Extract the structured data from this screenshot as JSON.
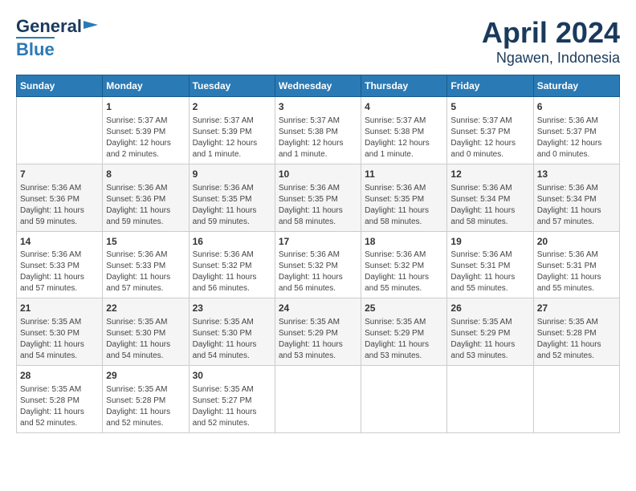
{
  "header": {
    "logo_line1": "General",
    "logo_line2": "Blue",
    "title": "April 2024",
    "subtitle": "Ngawen, Indonesia"
  },
  "columns": [
    "Sunday",
    "Monday",
    "Tuesday",
    "Wednesday",
    "Thursday",
    "Friday",
    "Saturday"
  ],
  "weeks": [
    [
      {
        "day": "",
        "info": ""
      },
      {
        "day": "1",
        "info": "Sunrise: 5:37 AM\nSunset: 5:39 PM\nDaylight: 12 hours\nand 2 minutes."
      },
      {
        "day": "2",
        "info": "Sunrise: 5:37 AM\nSunset: 5:39 PM\nDaylight: 12 hours\nand 1 minute."
      },
      {
        "day": "3",
        "info": "Sunrise: 5:37 AM\nSunset: 5:38 PM\nDaylight: 12 hours\nand 1 minute."
      },
      {
        "day": "4",
        "info": "Sunrise: 5:37 AM\nSunset: 5:38 PM\nDaylight: 12 hours\nand 1 minute."
      },
      {
        "day": "5",
        "info": "Sunrise: 5:37 AM\nSunset: 5:37 PM\nDaylight: 12 hours\nand 0 minutes."
      },
      {
        "day": "6",
        "info": "Sunrise: 5:36 AM\nSunset: 5:37 PM\nDaylight: 12 hours\nand 0 minutes."
      }
    ],
    [
      {
        "day": "7",
        "info": "Sunrise: 5:36 AM\nSunset: 5:36 PM\nDaylight: 11 hours\nand 59 minutes."
      },
      {
        "day": "8",
        "info": "Sunrise: 5:36 AM\nSunset: 5:36 PM\nDaylight: 11 hours\nand 59 minutes."
      },
      {
        "day": "9",
        "info": "Sunrise: 5:36 AM\nSunset: 5:35 PM\nDaylight: 11 hours\nand 59 minutes."
      },
      {
        "day": "10",
        "info": "Sunrise: 5:36 AM\nSunset: 5:35 PM\nDaylight: 11 hours\nand 58 minutes."
      },
      {
        "day": "11",
        "info": "Sunrise: 5:36 AM\nSunset: 5:35 PM\nDaylight: 11 hours\nand 58 minutes."
      },
      {
        "day": "12",
        "info": "Sunrise: 5:36 AM\nSunset: 5:34 PM\nDaylight: 11 hours\nand 58 minutes."
      },
      {
        "day": "13",
        "info": "Sunrise: 5:36 AM\nSunset: 5:34 PM\nDaylight: 11 hours\nand 57 minutes."
      }
    ],
    [
      {
        "day": "14",
        "info": "Sunrise: 5:36 AM\nSunset: 5:33 PM\nDaylight: 11 hours\nand 57 minutes."
      },
      {
        "day": "15",
        "info": "Sunrise: 5:36 AM\nSunset: 5:33 PM\nDaylight: 11 hours\nand 57 minutes."
      },
      {
        "day": "16",
        "info": "Sunrise: 5:36 AM\nSunset: 5:32 PM\nDaylight: 11 hours\nand 56 minutes."
      },
      {
        "day": "17",
        "info": "Sunrise: 5:36 AM\nSunset: 5:32 PM\nDaylight: 11 hours\nand 56 minutes."
      },
      {
        "day": "18",
        "info": "Sunrise: 5:36 AM\nSunset: 5:32 PM\nDaylight: 11 hours\nand 55 minutes."
      },
      {
        "day": "19",
        "info": "Sunrise: 5:36 AM\nSunset: 5:31 PM\nDaylight: 11 hours\nand 55 minutes."
      },
      {
        "day": "20",
        "info": "Sunrise: 5:36 AM\nSunset: 5:31 PM\nDaylight: 11 hours\nand 55 minutes."
      }
    ],
    [
      {
        "day": "21",
        "info": "Sunrise: 5:35 AM\nSunset: 5:30 PM\nDaylight: 11 hours\nand 54 minutes."
      },
      {
        "day": "22",
        "info": "Sunrise: 5:35 AM\nSunset: 5:30 PM\nDaylight: 11 hours\nand 54 minutes."
      },
      {
        "day": "23",
        "info": "Sunrise: 5:35 AM\nSunset: 5:30 PM\nDaylight: 11 hours\nand 54 minutes."
      },
      {
        "day": "24",
        "info": "Sunrise: 5:35 AM\nSunset: 5:29 PM\nDaylight: 11 hours\nand 53 minutes."
      },
      {
        "day": "25",
        "info": "Sunrise: 5:35 AM\nSunset: 5:29 PM\nDaylight: 11 hours\nand 53 minutes."
      },
      {
        "day": "26",
        "info": "Sunrise: 5:35 AM\nSunset: 5:29 PM\nDaylight: 11 hours\nand 53 minutes."
      },
      {
        "day": "27",
        "info": "Sunrise: 5:35 AM\nSunset: 5:28 PM\nDaylight: 11 hours\nand 52 minutes."
      }
    ],
    [
      {
        "day": "28",
        "info": "Sunrise: 5:35 AM\nSunset: 5:28 PM\nDaylight: 11 hours\nand 52 minutes."
      },
      {
        "day": "29",
        "info": "Sunrise: 5:35 AM\nSunset: 5:28 PM\nDaylight: 11 hours\nand 52 minutes."
      },
      {
        "day": "30",
        "info": "Sunrise: 5:35 AM\nSunset: 5:27 PM\nDaylight: 11 hours\nand 52 minutes."
      },
      {
        "day": "",
        "info": ""
      },
      {
        "day": "",
        "info": ""
      },
      {
        "day": "",
        "info": ""
      },
      {
        "day": "",
        "info": ""
      }
    ]
  ]
}
